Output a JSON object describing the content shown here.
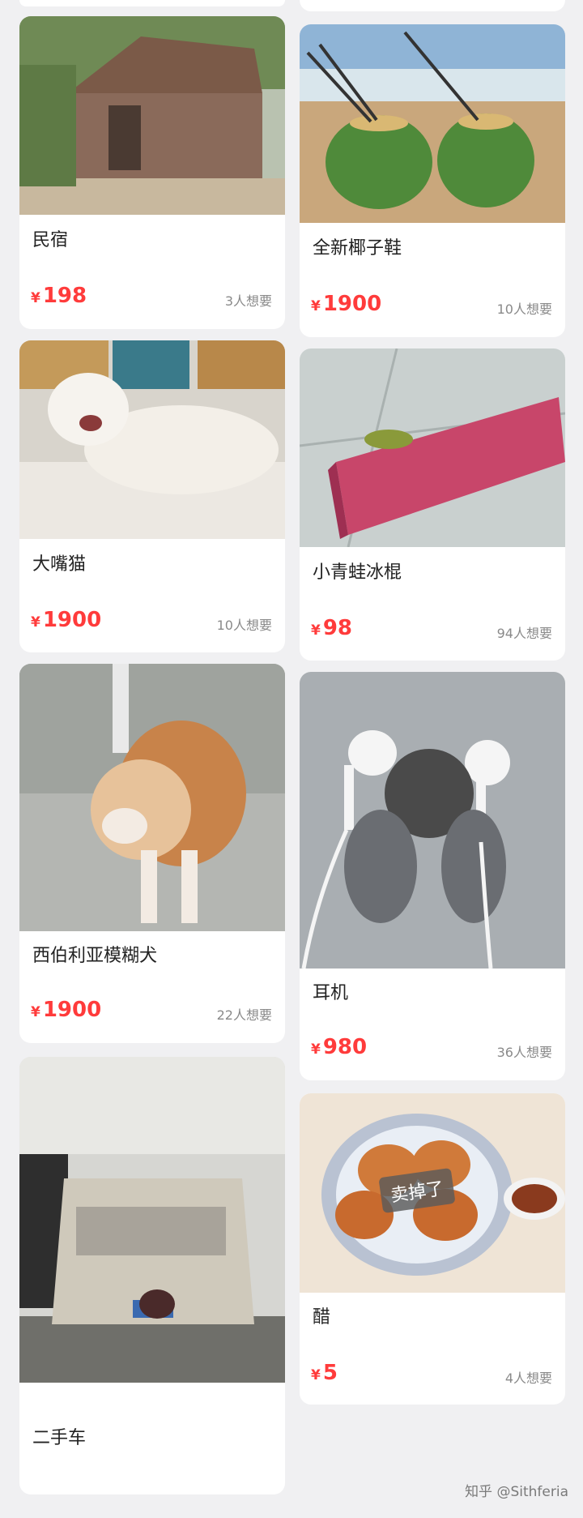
{
  "listings": [
    {
      "title": "民宿",
      "currency": "¥",
      "price": "198",
      "wants": "3人想要"
    },
    {
      "title": "全新椰子鞋",
      "currency": "¥",
      "price": "1900",
      "wants": "10人想要"
    },
    {
      "title": "大嘴猫",
      "currency": "¥",
      "price": "1900",
      "wants": "10人想要"
    },
    {
      "title": "小青蛙冰棍",
      "currency": "¥",
      "price": "98",
      "wants": "94人想要"
    },
    {
      "title": "西伯利亚模糊犬",
      "currency": "¥",
      "price": "1900",
      "wants": "22人想要"
    },
    {
      "title": "耳机",
      "currency": "¥",
      "price": "980",
      "wants": "36人想要"
    },
    {
      "title": "二手车"
    },
    {
      "title": "醋",
      "currency": "¥",
      "price": "5",
      "wants": "4人想要",
      "overlay": "卖掉了"
    }
  ],
  "watermark": "知乎 @Sithferia",
  "colors": {
    "price": "#ff3b3b",
    "background": "#f0f0f2",
    "card": "#ffffff"
  }
}
